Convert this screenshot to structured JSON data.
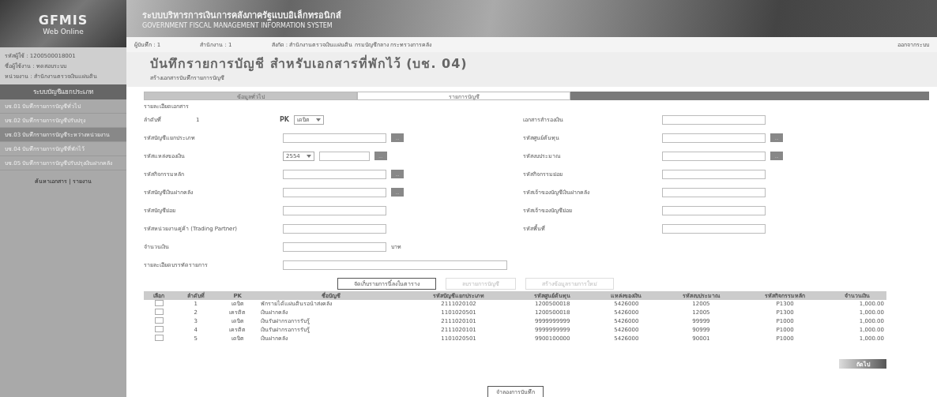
{
  "header": {
    "logo": "GFMIS",
    "logo_sub": "Web Online",
    "title_th": "ระบบบริหารการเงินการคลังภาครัฐแบบอิเล็กทรอนิกส์",
    "title_en": "GOVERNMENT FISCAL MANAGEMENT INFORMATION SYSTEM"
  },
  "sidebar": {
    "user_lines": [
      "รหัสผู้ใช้ : 1200500018001",
      "ชื่อผู้ใช้งาน : ทดสอบระบบ",
      "หน่วยงาน : สำนักงานตรวจเงินแผ่นดิน"
    ],
    "section": "ระบบบัญชีแยกประเภท",
    "items": [
      {
        "code": "บช.01",
        "label": "บันทึกรายการบัญชีทั่วไป",
        "selected": false
      },
      {
        "code": "บช.02",
        "label": "บันทึกรายการบัญชีปรับปรุง",
        "selected": false
      },
      {
        "code": "บช.03",
        "label": "บันทึกรายการบัญชีระหว่างหน่วยงาน",
        "selected": true
      },
      {
        "code": "บช.04",
        "label": "บันทึกรายการบัญชีที่พักไว้",
        "selected": false
      },
      {
        "code": "บช.05",
        "label": "บันทึกรายการบัญชีปรับปรุงเงินฝากคลัง",
        "selected": false
      }
    ],
    "footer": "ค้นหาเอกสาร | รายงาน"
  },
  "info_bar": {
    "user": "ผู้บันทึก : 1",
    "office": "สำนักงาน : 1",
    "affiliation": "สังกัด : สำนักงานตรวจเงินแผ่นดิน กรมบัญชีกลาง กระทรวงการคลัง",
    "logout": "ออกจากระบบ"
  },
  "page_title": "บันทึกรายการบัญชี สำหรับเอกสารที่พักไว้ (บช. 04)",
  "page_subtitle": "สร้างเอกสารบันทึกรายการบัญชี",
  "tabs": [
    {
      "label": "ข้อมูลทั่วไป",
      "selected": false
    },
    {
      "label": "รายการบัญชี",
      "selected": true
    }
  ],
  "section_title": "รายละเอียดเอกสาร",
  "left_fields": [
    {
      "kind": "pk",
      "label": "ลำดับที่",
      "number": "1",
      "pk_label": "PK",
      "value": "เดบิต"
    },
    {
      "kind": "lookup",
      "label": "รหัสบัญชีแยกประเภท"
    },
    {
      "kind": "year_lookup",
      "label": "รหัสแหล่งของเงิน",
      "value": "2554"
    },
    {
      "kind": "lookup",
      "label": "รหัสกิจกรรมหลัก"
    },
    {
      "kind": "lookup",
      "label": "รหัสบัญชีเงินฝากคลัง"
    },
    {
      "kind": "text",
      "label": "รหัสบัญชีย่อย"
    },
    {
      "kind": "text",
      "label": "รหัสหน่วยงานคู่ค้า (Trading Partner)"
    },
    {
      "kind": "amount",
      "label": "จำนวนเงิน",
      "unit": "บาท"
    },
    {
      "kind": "wide",
      "label": "รายละเอียดบรรทัดรายการ"
    }
  ],
  "right_fields": [
    {
      "kind": "text",
      "label": "เอกสารสำรองเงิน"
    },
    {
      "kind": "lookup",
      "label": "รหัสศูนย์ต้นทุน"
    },
    {
      "kind": "lookup",
      "label": "รหัสงบประมาณ"
    },
    {
      "kind": "text",
      "label": "รหัสกิจกรรมย่อย"
    },
    {
      "kind": "text",
      "label": "รหัสเจ้าของบัญชีเงินฝากคลัง"
    },
    {
      "kind": "text",
      "label": "รหัสเจ้าของบัญชีย่อย"
    },
    {
      "kind": "text",
      "label": "รหัสพื้นที่"
    }
  ],
  "lookup_button": "...",
  "actions": [
    {
      "label": "จัดเก็บรายการนี้ลงในตาราง",
      "disabled": false
    },
    {
      "label": "ลบรายการบัญชี",
      "disabled": true
    },
    {
      "label": "สร้างข้อมูลรายการใหม่",
      "disabled": true
    }
  ],
  "table": {
    "columns": [
      "เลือก",
      "ลำดับที่",
      "PK",
      "ชื่อบัญชี",
      "รหัสบัญชีแยกประเภท",
      "รหัสศูนย์ต้นทุน",
      "แหล่งของเงิน",
      "รหัสงบประมาณ",
      "รหัสกิจกรรมหลัก",
      "จำนวนเงิน"
    ],
    "rows": [
      {
        "checked": false,
        "cells": [
          "",
          "1",
          "เดบิต",
          "พักรายได้แผ่นดินรอนำส่งคลัง",
          "2111020102",
          "1200500018",
          "5426000",
          "12005",
          "P1300",
          "1,000.00"
        ]
      },
      {
        "checked": false,
        "cells": [
          "",
          "2",
          "เครดิต",
          "เงินฝากคลัง",
          "1101020501",
          "1200500018",
          "5426000",
          "12005",
          "P1300",
          "1,000.00"
        ]
      },
      {
        "checked": false,
        "cells": [
          "",
          "3",
          "เดบิต",
          "เงินรับฝากรอการรับรู้",
          "2111020101",
          "9999999999",
          "5426000",
          "99999",
          "P1000",
          "1,000.00"
        ]
      },
      {
        "checked": false,
        "cells": [
          "",
          "4",
          "เครดิต",
          "เงินรับฝากรอการรับรู้",
          "2111020101",
          "9999999999",
          "5426000",
          "90999",
          "P1000",
          "1,000.00"
        ]
      },
      {
        "checked": false,
        "cells": [
          "",
          "5",
          "เดบิต",
          "เงินฝากคลัง",
          "1101020501",
          "9900100000",
          "5426000",
          "90001",
          "P1000",
          "1,000.00"
        ]
      }
    ]
  },
  "next_button": "ถัดไป",
  "simulate_button": "จำลองการบันทึก"
}
